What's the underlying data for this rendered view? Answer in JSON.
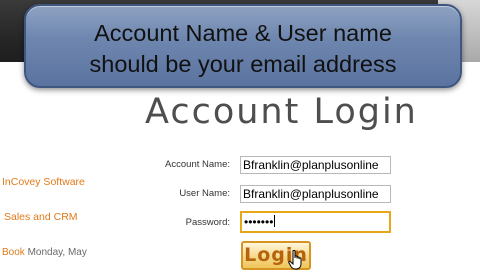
{
  "callout": {
    "line1": "Account Name & User name",
    "line2": "should be your email address"
  },
  "page": {
    "title": "Account Login"
  },
  "sidebar": {
    "link1": "InCovey Software",
    "link2": "Sales and CRM",
    "book_label": "Book",
    "date_text": "Monday, May"
  },
  "form": {
    "account_name_label": "Account Name:",
    "account_name_value": "Bfranklin@planplusonline",
    "user_name_label": "User Name:",
    "user_name_value": "Bfranklin@planplusonline",
    "password_label": "Password:",
    "password_mask": "•••••••",
    "login_label": "Login"
  },
  "icons": {
    "cursor": "hand-pointer-icon"
  },
  "colors": {
    "accent_orange": "#e07a1a",
    "button_border": "#d69522",
    "focus_border": "#e6a817",
    "callout_blue": "#6f87af"
  }
}
